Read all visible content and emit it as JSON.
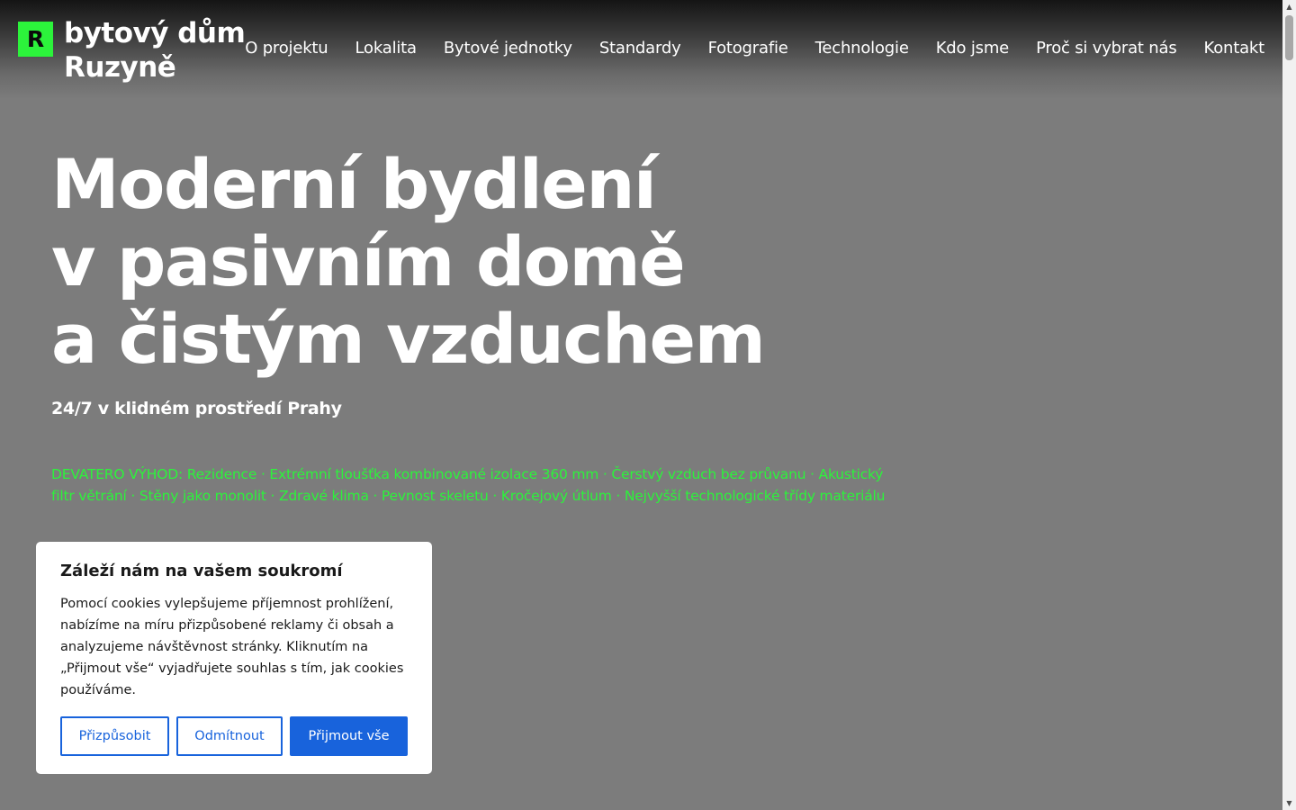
{
  "brand": {
    "logo_letter": "R",
    "line1": "bytový dům",
    "line2": "Ruzyně",
    "accent_color": "#2cf33b"
  },
  "nav": {
    "items": [
      {
        "label": "O projektu"
      },
      {
        "label": "Lokalita"
      },
      {
        "label": "Bytové jednotky"
      },
      {
        "label": "Standardy"
      },
      {
        "label": "Fotografie"
      },
      {
        "label": "Technologie"
      },
      {
        "label": "Kdo jsme"
      },
      {
        "label": "Proč si vybrat nás"
      },
      {
        "label": "Kontakt"
      }
    ]
  },
  "hero": {
    "title_line1": "Moderní bydlení",
    "title_line2": "v pasivním domě",
    "title_line3": "a čistým vzduchem",
    "subtitle": "24/7 v klidném prostředí Prahy",
    "benefits": "DEVATERO VÝHOD: Rezidence · Extrémní tloušťka kombinované izolace 360 mm · Čerstvý vzduch bez průvanu · Akustický filtr větrání · Stěny jako monolit · Zdravé klima · Pevnost skeletu · Kročejový útlum · Nejvyšší technologické třídy materiálu"
  },
  "cookie": {
    "title": "Záleží nám na vašem soukromí",
    "text": "Pomocí cookies vylepšujeme příjemnost prohlížení, nabízíme na míru přizpůsobené reklamy či obsah a analyzujeme návštěvnost stránky. Kliknutím na „Přijmout vše“ vyjadřujete souhlas s tím, jak cookies používáme.",
    "customize_label": "Přizpůsobit",
    "reject_label": "Odmítnout",
    "accept_label": "Přijmout vše",
    "button_color": "#1863dc"
  },
  "scrollbar": {
    "up_icon": "triangle-up-icon",
    "down_icon": "triangle-down-icon"
  }
}
